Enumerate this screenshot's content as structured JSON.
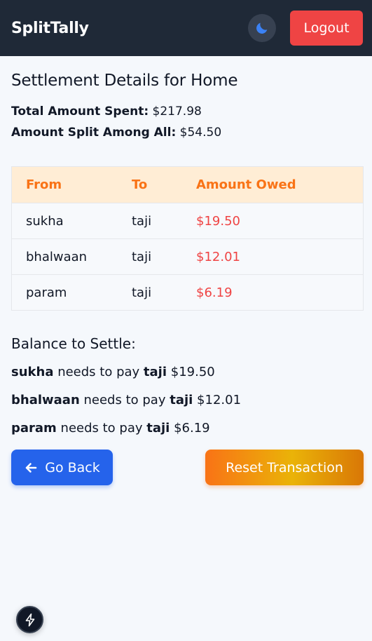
{
  "navbar": {
    "brand": "SplitTally",
    "theme_icon": "moon-icon",
    "logout_label": "Logout"
  },
  "page": {
    "title": "Settlement Details for Home",
    "total_label": "Total Amount Spent:",
    "total_value": "$217.98",
    "split_label": "Amount Split Among All:",
    "split_value": "$54.50"
  },
  "table": {
    "headers": [
      "From",
      "To",
      "Amount Owed"
    ],
    "rows": [
      {
        "from": "sukha",
        "to": "taji",
        "amount": "$19.50"
      },
      {
        "from": "bhalwaan",
        "to": "taji",
        "amount": "$12.01"
      },
      {
        "from": "param",
        "to": "taji",
        "amount": "$6.19"
      }
    ]
  },
  "balance": {
    "title": "Balance to Settle:",
    "connector": "needs to pay",
    "items": [
      {
        "from": "sukha",
        "to": "taji",
        "amount": "$19.50"
      },
      {
        "from": "bhalwaan",
        "to": "taji",
        "amount": "$12.01"
      },
      {
        "from": "param",
        "to": "taji",
        "amount": "$6.19"
      }
    ]
  },
  "actions": {
    "back_label": "Go Back",
    "back_icon": "arrow-left-icon",
    "reset_label": "Reset Transaction"
  },
  "floating": {
    "icon": "lightning-bolt-icon"
  },
  "colors": {
    "navbar": "#1f2937",
    "logout": "#ef4444",
    "moon": "#3b82f6",
    "table_header_bg": "#ffedd5",
    "table_header_text": "#f97316",
    "amount": "#ef4444",
    "back_button": "#2563eb",
    "reset_gradient": [
      "#f97316",
      "#eab308",
      "#d97706"
    ]
  }
}
